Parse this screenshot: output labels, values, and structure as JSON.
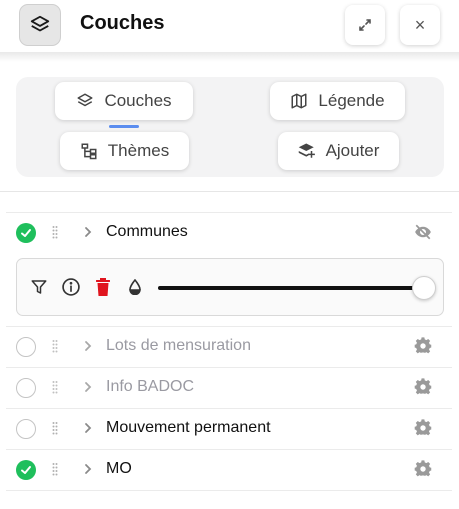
{
  "header": {
    "title": "Couches",
    "close_symbol": "×"
  },
  "tabs": [
    {
      "label": "Couches",
      "icon": "layers-icon",
      "selected": true
    },
    {
      "label": "Légende",
      "icon": "map-icon",
      "selected": false
    },
    {
      "label": "Thèmes",
      "icon": "tree-icon",
      "selected": false
    },
    {
      "label": "Ajouter",
      "icon": "add-layer-icon",
      "selected": false
    }
  ],
  "layers": [
    {
      "label": "Communes",
      "checked": true,
      "active": true,
      "right_icon": "visibility-off-icon",
      "expanded": true
    },
    {
      "label": "Lots de mensuration",
      "checked": false,
      "active": false,
      "right_icon": "gear-icon"
    },
    {
      "label": "Info BADOC",
      "checked": false,
      "active": false,
      "right_icon": "gear-icon"
    },
    {
      "label": "Mouvement permanent",
      "checked": false,
      "active": true,
      "right_icon": "gear-icon"
    },
    {
      "label": "MO",
      "checked": true,
      "active": true,
      "right_icon": "gear-icon"
    }
  ],
  "layer_tools": {
    "icons": [
      "filter-icon",
      "info-icon",
      "delete-icon",
      "opacity-icon"
    ],
    "opacity": 1.0
  },
  "colors": {
    "accent": "#5b8def",
    "checked": "#1fbf5c",
    "delete": "#e0141e"
  }
}
